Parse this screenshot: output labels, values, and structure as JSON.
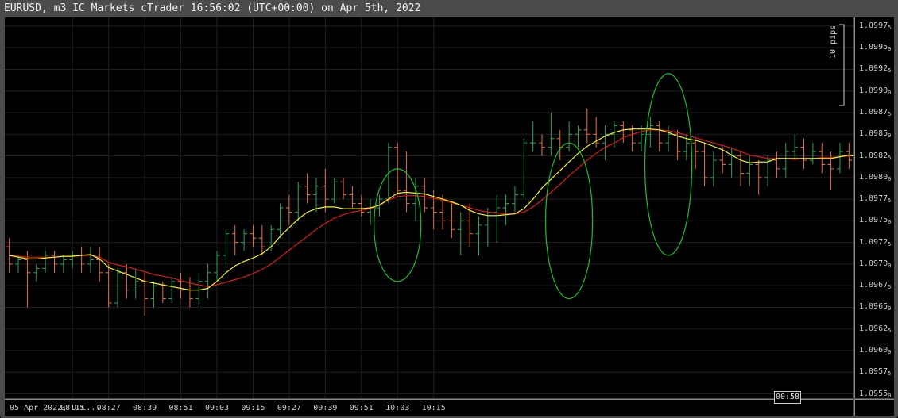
{
  "window": {
    "title": "EURUSD, m3 IC Markets cTrader 16:56:02 (UTC+00:00) on Apr 5th, 2022"
  },
  "chart_data": {
    "type": "candlestick",
    "symbol": "EURUSD",
    "timeframe": "m3",
    "colors": {
      "bull": "#26a65b",
      "bear": "#e8703a",
      "ema_fast": "#f5f51e",
      "ema_slow": "#e01818",
      "highlight": "#19c02a",
      "grid": "#1f1f1f"
    },
    "y_axis": {
      "range": [
        1.09545,
        1.09985
      ],
      "ticks": [
        {
          "main": "1.0997",
          "sub": "5",
          "value": 1.09975
        },
        {
          "main": "1.0995",
          "sub": "0",
          "value": 1.0995
        },
        {
          "main": "1.0992",
          "sub": "5",
          "value": 1.09925
        },
        {
          "main": "1.0990",
          "sub": "0",
          "value": 1.099
        },
        {
          "main": "1.0987",
          "sub": "5",
          "value": 1.09875
        },
        {
          "main": "1.0985",
          "sub": "0",
          "value": 1.0985
        },
        {
          "main": "1.0982",
          "sub": "5",
          "value": 1.09825
        },
        {
          "main": "1.0980",
          "sub": "0",
          "value": 1.098
        },
        {
          "main": "1.0977",
          "sub": "5",
          "value": 1.09775
        },
        {
          "main": "1.0975",
          "sub": "0",
          "value": 1.0975
        },
        {
          "main": "1.0972",
          "sub": "5",
          "value": 1.09725
        },
        {
          "main": "1.0970",
          "sub": "0",
          "value": 1.097
        },
        {
          "main": "1.0967",
          "sub": "5",
          "value": 1.09675
        },
        {
          "main": "1.0965",
          "sub": "0",
          "value": 1.0965
        },
        {
          "main": "1.0962",
          "sub": "5",
          "value": 1.09625
        },
        {
          "main": "1.0960",
          "sub": "0",
          "value": 1.096
        },
        {
          "main": "1.0957",
          "sub": "5",
          "value": 1.09575
        },
        {
          "main": "1.0955",
          "sub": "0",
          "value": 1.0955
        }
      ]
    },
    "x_axis": {
      "labels": [
        "05 Apr 2022, UTC...",
        "08:15",
        "08:27",
        "08:39",
        "08:51",
        "09:03",
        "09:15",
        "09:27",
        "09:39",
        "09:51",
        "10:03",
        "10:15"
      ]
    },
    "pip_scale_label": "10 pips",
    "cursor_time": "00:58",
    "candles": [
      {
        "o": 1.0972,
        "h": 1.0973,
        "l": 1.0969,
        "c": 1.097
      },
      {
        "o": 1.097,
        "h": 1.0971,
        "l": 1.0969,
        "c": 1.09705
      },
      {
        "o": 1.09705,
        "h": 1.09715,
        "l": 1.0965,
        "c": 1.0969
      },
      {
        "o": 1.0969,
        "h": 1.097,
        "l": 1.0968,
        "c": 1.09695
      },
      {
        "o": 1.09695,
        "h": 1.09715,
        "l": 1.0969,
        "c": 1.0971
      },
      {
        "o": 1.0971,
        "h": 1.09715,
        "l": 1.0969,
        "c": 1.097
      },
      {
        "o": 1.097,
        "h": 1.0971,
        "l": 1.0969,
        "c": 1.09705
      },
      {
        "o": 1.09705,
        "h": 1.09715,
        "l": 1.09695,
        "c": 1.0971
      },
      {
        "o": 1.0971,
        "h": 1.0972,
        "l": 1.0969,
        "c": 1.097
      },
      {
        "o": 1.097,
        "h": 1.0972,
        "l": 1.0969,
        "c": 1.09705
      },
      {
        "o": 1.09705,
        "h": 1.0972,
        "l": 1.0968,
        "c": 1.0969
      },
      {
        "o": 1.0969,
        "h": 1.097,
        "l": 1.0965,
        "c": 1.09655
      },
      {
        "o": 1.09655,
        "h": 1.09695,
        "l": 1.0965,
        "c": 1.0969
      },
      {
        "o": 1.0969,
        "h": 1.097,
        "l": 1.0966,
        "c": 1.0967
      },
      {
        "o": 1.0967,
        "h": 1.09695,
        "l": 1.0966,
        "c": 1.0968
      },
      {
        "o": 1.0968,
        "h": 1.0969,
        "l": 1.0964,
        "c": 1.0966
      },
      {
        "o": 1.0966,
        "h": 1.0968,
        "l": 1.0965,
        "c": 1.09675
      },
      {
        "o": 1.09675,
        "h": 1.0968,
        "l": 1.09655,
        "c": 1.0966
      },
      {
        "o": 1.0966,
        "h": 1.09685,
        "l": 1.09655,
        "c": 1.0968
      },
      {
        "o": 1.0968,
        "h": 1.0969,
        "l": 1.0966,
        "c": 1.0967
      },
      {
        "o": 1.0967,
        "h": 1.09685,
        "l": 1.0965,
        "c": 1.0966
      },
      {
        "o": 1.0966,
        "h": 1.0969,
        "l": 1.0965,
        "c": 1.0968
      },
      {
        "o": 1.0968,
        "h": 1.097,
        "l": 1.0966,
        "c": 1.0969
      },
      {
        "o": 1.0969,
        "h": 1.09715,
        "l": 1.0968,
        "c": 1.0971
      },
      {
        "o": 1.0971,
        "h": 1.0974,
        "l": 1.097,
        "c": 1.09735
      },
      {
        "o": 1.09735,
        "h": 1.09745,
        "l": 1.0971,
        "c": 1.09725
      },
      {
        "o": 1.09725,
        "h": 1.0974,
        "l": 1.09715,
        "c": 1.09735
      },
      {
        "o": 1.09735,
        "h": 1.09745,
        "l": 1.0972,
        "c": 1.0973
      },
      {
        "o": 1.0973,
        "h": 1.09745,
        "l": 1.0971,
        "c": 1.0972
      },
      {
        "o": 1.0972,
        "h": 1.09745,
        "l": 1.09715,
        "c": 1.0974
      },
      {
        "o": 1.0974,
        "h": 1.0977,
        "l": 1.0973,
        "c": 1.09765
      },
      {
        "o": 1.09765,
        "h": 1.0978,
        "l": 1.09745,
        "c": 1.0976
      },
      {
        "o": 1.0976,
        "h": 1.09795,
        "l": 1.0975,
        "c": 1.0979
      },
      {
        "o": 1.0979,
        "h": 1.09805,
        "l": 1.0977,
        "c": 1.0978
      },
      {
        "o": 1.0978,
        "h": 1.098,
        "l": 1.0976,
        "c": 1.0979
      },
      {
        "o": 1.0979,
        "h": 1.0981,
        "l": 1.0976,
        "c": 1.09775
      },
      {
        "o": 1.09775,
        "h": 1.098,
        "l": 1.0977,
        "c": 1.09795
      },
      {
        "o": 1.09795,
        "h": 1.098,
        "l": 1.09775,
        "c": 1.0978
      },
      {
        "o": 1.0978,
        "h": 1.0979,
        "l": 1.09765,
        "c": 1.0977
      },
      {
        "o": 1.0977,
        "h": 1.0978,
        "l": 1.09755,
        "c": 1.0976
      },
      {
        "o": 1.0976,
        "h": 1.09775,
        "l": 1.09745,
        "c": 1.09765
      },
      {
        "o": 1.09765,
        "h": 1.0978,
        "l": 1.09755,
        "c": 1.09775
      },
      {
        "o": 1.09775,
        "h": 1.0984,
        "l": 1.0977,
        "c": 1.09835
      },
      {
        "o": 1.09835,
        "h": 1.0984,
        "l": 1.0978,
        "c": 1.09785
      },
      {
        "o": 1.09785,
        "h": 1.0983,
        "l": 1.0976,
        "c": 1.0977
      },
      {
        "o": 1.0977,
        "h": 1.098,
        "l": 1.0975,
        "c": 1.0979
      },
      {
        "o": 1.0979,
        "h": 1.098,
        "l": 1.0976,
        "c": 1.09765
      },
      {
        "o": 1.09765,
        "h": 1.09785,
        "l": 1.0974,
        "c": 1.0976
      },
      {
        "o": 1.0976,
        "h": 1.0978,
        "l": 1.0974,
        "c": 1.0975
      },
      {
        "o": 1.0975,
        "h": 1.0977,
        "l": 1.0973,
        "c": 1.0974
      },
      {
        "o": 1.0974,
        "h": 1.0976,
        "l": 1.0971,
        "c": 1.0975
      },
      {
        "o": 1.0975,
        "h": 1.0977,
        "l": 1.0972,
        "c": 1.09735
      },
      {
        "o": 1.09735,
        "h": 1.09755,
        "l": 1.0971,
        "c": 1.09745
      },
      {
        "o": 1.09745,
        "h": 1.09765,
        "l": 1.0972,
        "c": 1.0976
      },
      {
        "o": 1.0976,
        "h": 1.0978,
        "l": 1.09725,
        "c": 1.09765
      },
      {
        "o": 1.09765,
        "h": 1.0978,
        "l": 1.09745,
        "c": 1.0977
      },
      {
        "o": 1.0977,
        "h": 1.0979,
        "l": 1.0976,
        "c": 1.0978
      },
      {
        "o": 1.0978,
        "h": 1.09845,
        "l": 1.09775,
        "c": 1.0984
      },
      {
        "o": 1.0984,
        "h": 1.09865,
        "l": 1.0983,
        "c": 1.0984
      },
      {
        "o": 1.0984,
        "h": 1.0985,
        "l": 1.09825,
        "c": 1.09835
      },
      {
        "o": 1.09835,
        "h": 1.09875,
        "l": 1.09825,
        "c": 1.09845
      },
      {
        "o": 1.09845,
        "h": 1.09855,
        "l": 1.0982,
        "c": 1.09835
      },
      {
        "o": 1.09835,
        "h": 1.09865,
        "l": 1.0983,
        "c": 1.0985
      },
      {
        "o": 1.0985,
        "h": 1.0986,
        "l": 1.09835,
        "c": 1.09855
      },
      {
        "o": 1.09855,
        "h": 1.0988,
        "l": 1.0984,
        "c": 1.0985
      },
      {
        "o": 1.0985,
        "h": 1.0987,
        "l": 1.09835,
        "c": 1.0984
      },
      {
        "o": 1.0984,
        "h": 1.0986,
        "l": 1.0982,
        "c": 1.0985
      },
      {
        "o": 1.0985,
        "h": 1.09865,
        "l": 1.09835,
        "c": 1.0986
      },
      {
        "o": 1.0986,
        "h": 1.09865,
        "l": 1.0984,
        "c": 1.09855
      },
      {
        "o": 1.09855,
        "h": 1.0986,
        "l": 1.0983,
        "c": 1.0984
      },
      {
        "o": 1.0984,
        "h": 1.0986,
        "l": 1.0983,
        "c": 1.0985
      },
      {
        "o": 1.0985,
        "h": 1.0987,
        "l": 1.09835,
        "c": 1.0986
      },
      {
        "o": 1.0986,
        "h": 1.09865,
        "l": 1.0983,
        "c": 1.0984
      },
      {
        "o": 1.0984,
        "h": 1.0986,
        "l": 1.0983,
        "c": 1.0985
      },
      {
        "o": 1.0985,
        "h": 1.09855,
        "l": 1.0982,
        "c": 1.0983
      },
      {
        "o": 1.0983,
        "h": 1.0985,
        "l": 1.0982,
        "c": 1.0984
      },
      {
        "o": 1.0984,
        "h": 1.09845,
        "l": 1.0981,
        "c": 1.0983
      },
      {
        "o": 1.0983,
        "h": 1.0984,
        "l": 1.0979,
        "c": 1.098
      },
      {
        "o": 1.098,
        "h": 1.0983,
        "l": 1.0979,
        "c": 1.0982
      },
      {
        "o": 1.0982,
        "h": 1.09835,
        "l": 1.09805,
        "c": 1.09815
      },
      {
        "o": 1.09815,
        "h": 1.09835,
        "l": 1.098,
        "c": 1.09825
      },
      {
        "o": 1.09825,
        "h": 1.0983,
        "l": 1.0979,
        "c": 1.09805
      },
      {
        "o": 1.09805,
        "h": 1.09825,
        "l": 1.0979,
        "c": 1.09815
      },
      {
        "o": 1.09815,
        "h": 1.0982,
        "l": 1.0978,
        "c": 1.098
      },
      {
        "o": 1.098,
        "h": 1.09825,
        "l": 1.0979,
        "c": 1.0982
      },
      {
        "o": 1.0982,
        "h": 1.0983,
        "l": 1.098,
        "c": 1.0981
      },
      {
        "o": 1.0981,
        "h": 1.0984,
        "l": 1.098,
        "c": 1.0983
      },
      {
        "o": 1.0983,
        "h": 1.0985,
        "l": 1.0982,
        "c": 1.09835
      },
      {
        "o": 1.09835,
        "h": 1.09845,
        "l": 1.0981,
        "c": 1.0982
      },
      {
        "o": 1.0982,
        "h": 1.0984,
        "l": 1.09815,
        "c": 1.0983
      },
      {
        "o": 1.0983,
        "h": 1.0984,
        "l": 1.09805,
        "c": 1.09815
      },
      {
        "o": 1.09815,
        "h": 1.0983,
        "l": 1.09785,
        "c": 1.0981
      },
      {
        "o": 1.0981,
        "h": 1.0984,
        "l": 1.09805,
        "c": 1.0983
      },
      {
        "o": 1.0983,
        "h": 1.0984,
        "l": 1.0981,
        "c": 1.0982
      }
    ],
    "ema_fast": [
      1.0971,
      1.09708,
      1.09706,
      1.09706,
      1.09707,
      1.09708,
      1.09709,
      1.09709,
      1.0971,
      1.09711,
      1.09706,
      1.09696,
      1.09692,
      1.09688,
      1.09684,
      1.0968,
      1.09678,
      1.09676,
      1.09674,
      1.09672,
      1.0967,
      1.0967,
      1.09672,
      1.0968,
      1.0969,
      1.09698,
      1.09703,
      1.09707,
      1.09712,
      1.0972,
      1.09732,
      1.09742,
      1.09752,
      1.0976,
      1.09764,
      1.09766,
      1.09766,
      1.09764,
      1.09764,
      1.09764,
      1.09765,
      1.09768,
      1.09775,
      1.09782,
      1.09783,
      1.09782,
      1.09781,
      1.09778,
      1.09775,
      1.09772,
      1.09768,
      1.09762,
      1.09758,
      1.09756,
      1.09756,
      1.09757,
      1.09758,
      1.09764,
      1.09775,
      1.09788,
      1.09798,
      1.09808,
      1.09818,
      1.09828,
      1.09836,
      1.09842,
      1.09848,
      1.09852,
      1.09855,
      1.09856,
      1.09856,
      1.09856,
      1.09855,
      1.09852,
      1.09848,
      1.09845,
      1.09843,
      1.0984,
      1.09836,
      1.09832,
      1.09826,
      1.0982,
      1.09817,
      1.09818,
      1.09818,
      1.09822,
      1.09822,
      1.09822,
      1.09822,
      1.09822,
      1.09822,
      1.09822,
      1.09824,
      1.09826,
      1.09824,
      1.09822,
      1.09822
    ],
    "ema_slow": [
      1.0971,
      1.09709,
      1.09708,
      1.09708,
      1.09708,
      1.09708,
      1.09709,
      1.09709,
      1.0971,
      1.0971,
      1.09708,
      1.09702,
      1.09699,
      1.09697,
      1.09694,
      1.09691,
      1.09688,
      1.09686,
      1.09684,
      1.09681,
      1.09678,
      1.09676,
      1.09674,
      1.09676,
      1.09679,
      1.09682,
      1.09685,
      1.09689,
      1.09694,
      1.097,
      1.09708,
      1.09716,
      1.09724,
      1.09732,
      1.0974,
      1.09747,
      1.09753,
      1.09757,
      1.0976,
      1.09762,
      1.09764,
      1.09768,
      1.09774,
      1.09778,
      1.09779,
      1.09779,
      1.09778,
      1.09776,
      1.09774,
      1.09771,
      1.09768,
      1.09765,
      1.09762,
      1.0976,
      1.09759,
      1.09758,
      1.09758,
      1.0976,
      1.09766,
      1.09774,
      1.09783,
      1.09792,
      1.09802,
      1.09811,
      1.0982,
      1.09828,
      1.09835,
      1.0984,
      1.09846,
      1.0985,
      1.09853,
      1.09855,
      1.09855,
      1.09854,
      1.09852,
      1.09849,
      1.09846,
      1.09843,
      1.0984,
      1.09837,
      1.09834,
      1.0983,
      1.09826,
      1.09824,
      1.09822,
      1.09822,
      1.09822,
      1.09821,
      1.09822,
      1.09822,
      1.09823,
      1.09823,
      1.09824,
      1.09825,
      1.09825,
      1.09824,
      1.09823
    ],
    "highlights": [
      {
        "center_index": 43,
        "top": 1.0981,
        "bottom": 1.0968
      },
      {
        "center_index": 62,
        "top": 1.0984,
        "bottom": 1.0966
      },
      {
        "center_index": 73,
        "top": 1.0992,
        "bottom": 1.0971
      }
    ]
  }
}
